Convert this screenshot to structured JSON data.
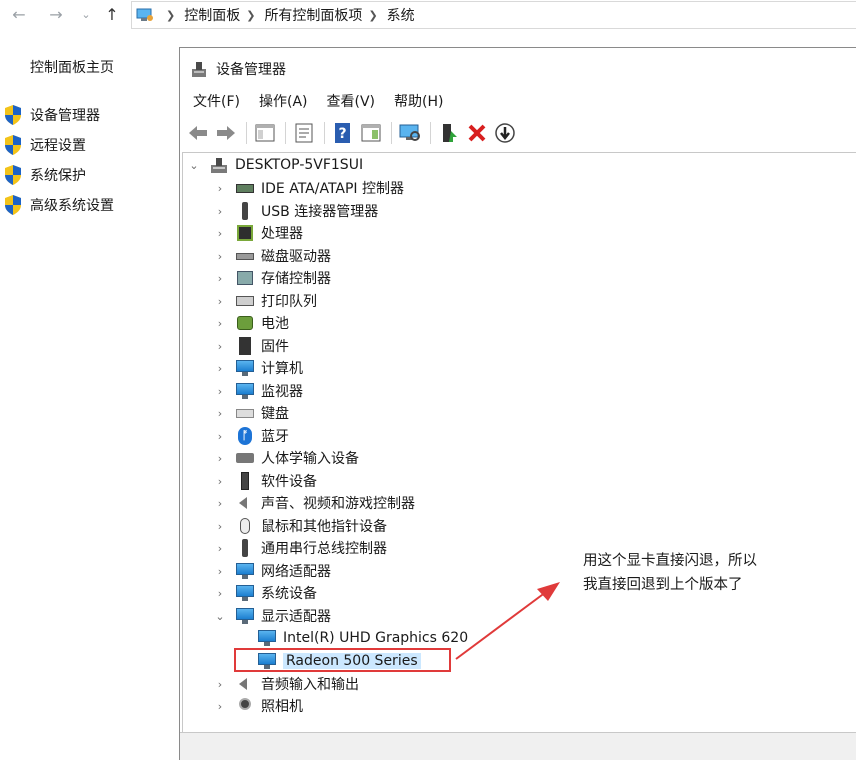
{
  "address": {
    "crumbs": [
      "控制面板",
      "所有控制面板项",
      "系统"
    ]
  },
  "left_pane": {
    "home": "控制面板主页",
    "links": [
      "设备管理器",
      "远程设置",
      "系统保护",
      "高级系统设置"
    ]
  },
  "window": {
    "title": "设备管理器",
    "menus": [
      "文件(F)",
      "操作(A)",
      "查看(V)",
      "帮助(H)"
    ],
    "tree": {
      "root": "DESKTOP-5VF1SUI",
      "categories": [
        "IDE ATA/ATAPI 控制器",
        "USB 连接器管理器",
        "处理器",
        "磁盘驱动器",
        "存储控制器",
        "打印队列",
        "电池",
        "固件",
        "计算机",
        "监视器",
        "键盘",
        "蓝牙",
        "人体学输入设备",
        "软件设备",
        "声音、视频和游戏控制器",
        "鼠标和其他指针设备",
        "通用串行总线控制器",
        "网络适配器",
        "系统设备",
        "显示适配器",
        "音频输入和输出",
        "照相机"
      ],
      "display_children": [
        "Intel(R) UHD Graphics 620",
        "Radeon 500 Series"
      ]
    }
  },
  "annotation": {
    "line1": "用这个显卡直接闪退，所以",
    "line2": "我直接回退到上个版本了"
  },
  "colors": {
    "highlight_border": "#e03a3a",
    "selection_bg": "#cce8ff",
    "shield_blue": "#1d63c6",
    "shield_yellow": "#f3c319"
  }
}
